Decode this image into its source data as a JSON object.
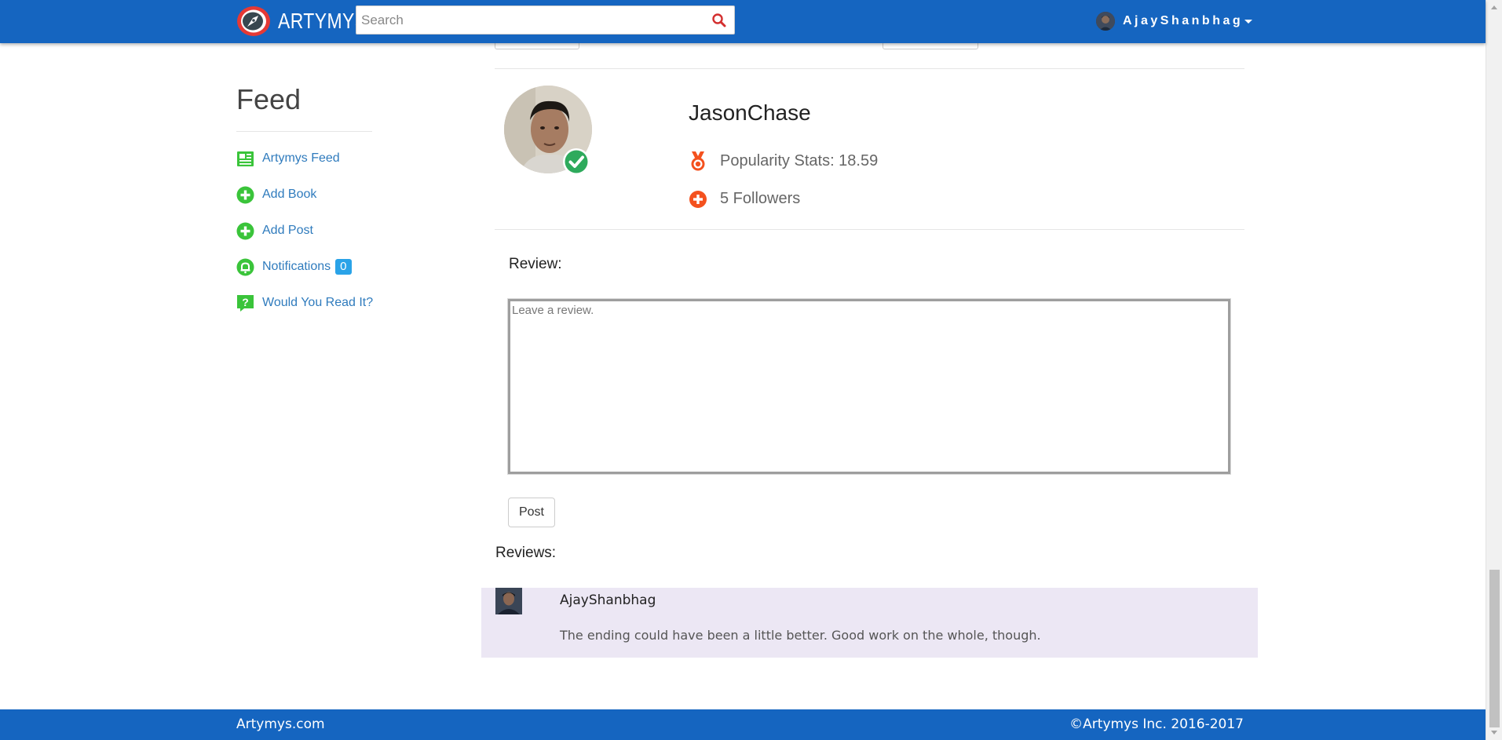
{
  "header": {
    "brand": "ARTYMYS",
    "search": {
      "placeholder": "Search",
      "value": ""
    },
    "user": {
      "name": "AjayShanbhag"
    }
  },
  "sidebar": {
    "title": "Feed",
    "items": [
      {
        "label": "Artymys Feed",
        "icon": "newspaper-icon"
      },
      {
        "label": "Add Book",
        "icon": "plus-circle-icon"
      },
      {
        "label": "Add Post",
        "icon": "plus-circle-icon"
      },
      {
        "label": "Notifications",
        "icon": "bell-icon",
        "badge": "0"
      },
      {
        "label": "Would You Read It?",
        "icon": "question-icon"
      }
    ]
  },
  "profile": {
    "name": "JasonChase",
    "popularity": "Popularity Stats: 18.59",
    "followers": "5 Followers"
  },
  "review_form": {
    "label": "Review:",
    "placeholder": "Leave a review.",
    "value": "",
    "post_label": "Post"
  },
  "reviews": {
    "label": "Reviews:",
    "items": [
      {
        "user": "AjayShanbhag",
        "text": "The ending could have been a little better. Good work on the whole, though."
      }
    ]
  },
  "footer": {
    "left": "Artymys.com",
    "right": "©Artymys Inc. 2016-2017"
  },
  "colors": {
    "navbar": "#1565c0",
    "link": "#2f7bbd",
    "sidebar_icon": "#3ac43a",
    "badge": "#2aa3e8",
    "stat_icon": "#f4511e",
    "verified": "#2eaa5c",
    "review_card": "#ece7f4"
  }
}
